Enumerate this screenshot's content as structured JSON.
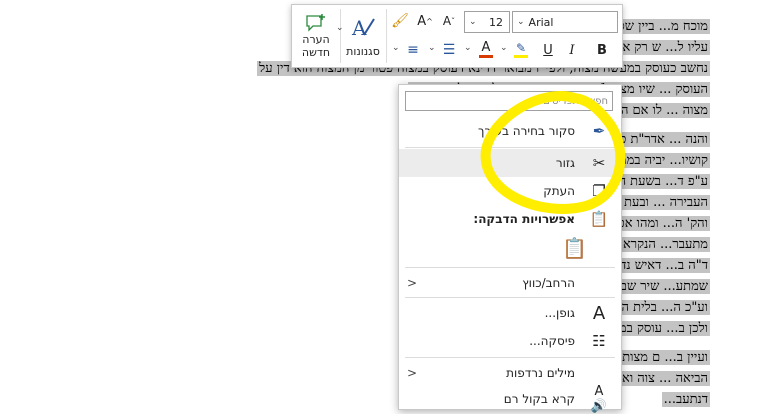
{
  "document": {
    "para1": [
      "מוכח מ... ביין שסו\"ס הוא עושה מה שמוטל",
      "עליו ל... ש רק אם הוא ראוי להיוולד בנים ע\"י מ\"מ",
      "נחשב כעוסק במעשה מצוה, ולפי\"ז מבואר דדינא דעוסק במצוה פטור מן המצוה הוא דין על",
      "העוסק ... שיו מצוה [וכתבתי במקום אחר לחקור לענין חוסף",
      "מצוה ... לו אם הוא בלוחץ המעשה מצוה או קיום המצוה]"
    ],
    "para2": [
      "והנה ... אדר\"ת כאן במצוה א' שהביא דברי המנ\"ח שתירץ",
      "קושיו... יביה בממזר והלא מצוה הבא בעבירה הוא, ותירץ",
      "ע\"פ ד... בשעת העבירה לא הוי מצוה הבא בעבירה, והכא",
      "העבירה ... ובעת הולדת הבנים אין עוד עבירה בעולם עכ\"ד,",
      "והק' ה... ומהו אטו העבירה אינה מצוה כלל, ונהי שאין אשה",
      "מתעבר... הנקרא בעילת מצוה ועיין תוספות כתובות דף ד.",
      "ד\"ה ב... דאיש נדבק בה וע\"ז באין לידי פו\"ר, וכ\"ש בביאה",
      "שמתע... שיר שם והביא כהנ\"ל מהא דתתן דפטור מקריא\"ש",
      "וע\"כ ה... בלית ה' מעשיו ותתעבר למפרע קיים אז מצות פו\"ר",
      "ולכן ב... עוסק במצות פו\"ר עכ\"ל"
    ],
    "para3": [
      "ועיין ב... ם מצות פריה ורביה הוא ע\"י הטלת הזרע ומעשה",
      "הביאה ... צוה ואין המצוה בהעברה עיי\"ש שהוכיח כן מהא",
      "דנתעב... "
    ]
  },
  "toolbar": {
    "new_comment_label_1": "הערה",
    "new_comment_label_2": "חדשה",
    "styles_label": "סגנונות",
    "font_name": "Arial",
    "font_size": "12",
    "bold": "B",
    "italic": "I",
    "underline": "U",
    "grow_font": "A^",
    "shrink_font": "Aˇ",
    "font_color": "A",
    "highlight": "ab"
  },
  "menu": {
    "search_placeholder": "חפש בתפריטים",
    "items": [
      {
        "label": "סקור בחירה בעורך",
        "icon": "pen-icon"
      },
      {
        "label": "גזור",
        "icon": "scissors-icon"
      },
      {
        "label": "העתק",
        "icon": "copy-icon"
      }
    ],
    "paste_header": "אפשרויות הדבקה:",
    "expand_label": "הרחב/כווץ",
    "font_item": "גופן...",
    "paragraph_item": "פיסקה...",
    "synonyms_item": "מילים נרדפות",
    "read_aloud_item": "קרא בקול רם",
    "submenu_arrow": "<",
    "font_glyph": "A"
  },
  "colors": {
    "selection": "#c3c3c3",
    "highlight_yellow": "#ffee00",
    "font_color_red": "#d83b01",
    "accent_blue": "#2b579a"
  }
}
